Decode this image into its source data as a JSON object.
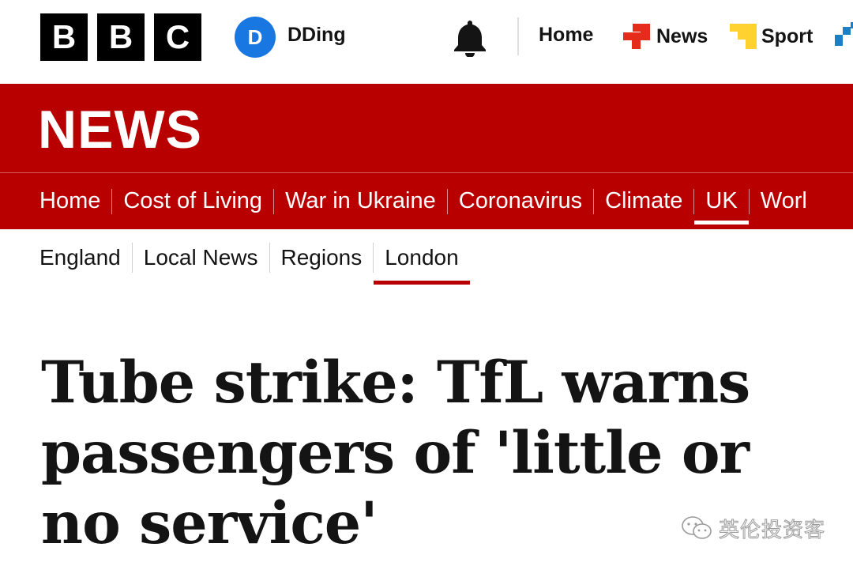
{
  "brand": {
    "logo_letters": [
      "B",
      "B",
      "C"
    ]
  },
  "account": {
    "avatar_initial": "D",
    "username": "DDing"
  },
  "top_nav": {
    "home": "Home",
    "news": "News",
    "sport": "Sport"
  },
  "banner": {
    "title": "NEWS"
  },
  "primary_nav": {
    "items": [
      "Home",
      "Cost of Living",
      "War in Ukraine",
      "Coronavirus",
      "Climate",
      "UK",
      "Worl"
    ],
    "active": "UK"
  },
  "secondary_nav": {
    "items": [
      "England",
      "Local News",
      "Regions",
      "London"
    ],
    "active": "London"
  },
  "article": {
    "headline": "Tube strike: TfL warns passengers of 'little or no service'"
  },
  "watermark": {
    "text": "英伦投资客",
    "icon": "wechat-icon"
  },
  "colors": {
    "brand_red": "#b80000",
    "avatar_blue": "#1877e0",
    "news_icon_red": "#e52b1a",
    "sport_icon_yellow": "#ffd230",
    "text": "#141414"
  }
}
